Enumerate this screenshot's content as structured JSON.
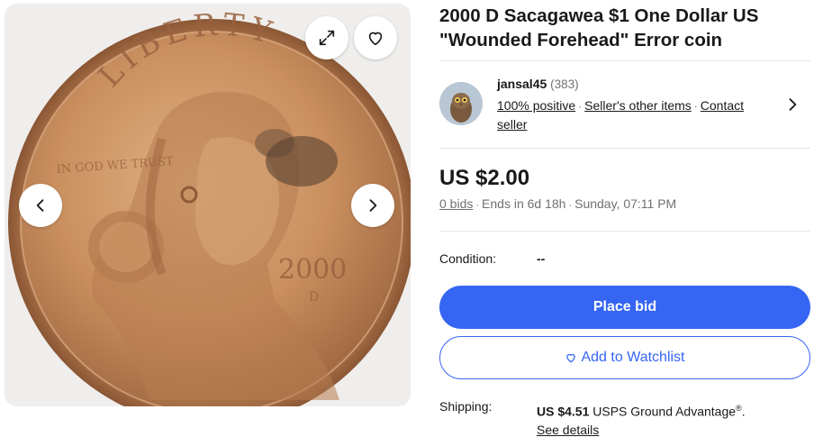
{
  "listing": {
    "title": "2000 D Sacagawea $1 One Dollar US \"Wounded Forehead\" Error coin"
  },
  "gallery": {
    "expand_icon": "expand-icon",
    "watch_icon": "heart-icon",
    "prev_icon": "chevron-left-icon",
    "next_icon": "chevron-right-icon",
    "coin_inscription": "LIBERTY",
    "coin_motto": "IN GOD WE TRUST",
    "coin_year": "2000",
    "coin_mint": "D"
  },
  "seller": {
    "name": "jansal45",
    "feedback_count": "(383)",
    "positive": "100% positive",
    "other_items": "Seller's other items",
    "contact": "Contact seller"
  },
  "price": {
    "amount": "US $2.00",
    "bids": "0 bids",
    "ends_in": "Ends in 6d 18h",
    "end_time": "Sunday, 07:11 PM"
  },
  "condition": {
    "label": "Condition:",
    "value": "--"
  },
  "actions": {
    "place_bid": "Place bid",
    "watchlist": "Add to Watchlist"
  },
  "shipping": {
    "label": "Shipping:",
    "price": "US $4.51",
    "service": "USPS Ground Advantage",
    "reg_mark": "®",
    "period": ".",
    "see_details": "See details"
  },
  "colors": {
    "accent": "#3665f3",
    "text": "#191919",
    "muted": "#707070",
    "coin_base": "#c98f5f"
  }
}
